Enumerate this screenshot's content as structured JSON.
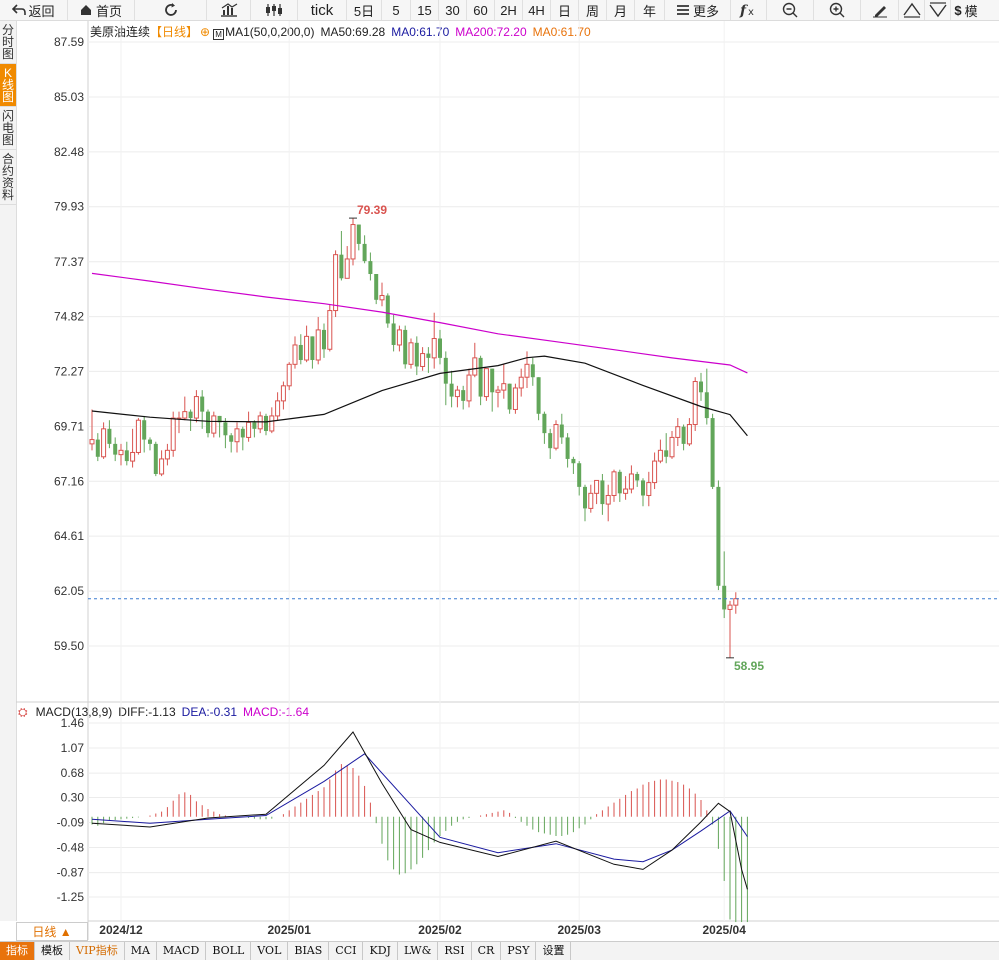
{
  "toolbar": {
    "back_label": "返回",
    "home_label": "首页",
    "tick_label": "tick",
    "periods": [
      "5日",
      "5",
      "15",
      "30",
      "60",
      "2H",
      "4H",
      "日",
      "周",
      "月",
      "年"
    ],
    "more_label": "更多",
    "model_label": "模"
  },
  "sidebar": {
    "items": [
      "分时图",
      "K线图",
      "闪电图",
      "合约资料"
    ],
    "active_index": 1
  },
  "main_legend": {
    "name": "美原油连续",
    "period": "【日线】",
    "ma_params": "MA1(50,0,200,0)",
    "ma50": "MA50:69.28",
    "ma0_a": "MA0:61.70",
    "ma200": "MA200:72.20",
    "ma0_b": "MA0:61.70"
  },
  "macd_legend": {
    "name": "MACD(13,8,9)",
    "diff": "DIFF:-1.13",
    "dea": "DEA:-0.31",
    "macd": "MACD:-1.64"
  },
  "period_tag": "日线 ▲",
  "bottom_tabs": [
    "指标",
    "模板",
    "VIP指标",
    "MA",
    "MACD",
    "BOLL",
    "VOL",
    "BIAS",
    "CCI",
    "KDJ",
    "LW&",
    "RSI",
    "CR",
    "PSY",
    "设置"
  ],
  "colors": {
    "up": "#d9534f",
    "down": "#62a65a",
    "ma50": "#111111",
    "ma200": "#cc00cc",
    "dea": "#1a1aa0",
    "accent": "#f08a00",
    "last_price_line": "#3b7bd0"
  },
  "chart_data": {
    "type": "candlestick",
    "title": "美原油连续",
    "price_axis_ticks": [
      87.59,
      85.03,
      82.48,
      79.93,
      77.37,
      74.82,
      72.27,
      69.71,
      67.16,
      64.61,
      62.05,
      59.5
    ],
    "ylim": [
      58.2,
      88.2
    ],
    "x_labels": [
      "2024/12",
      "2025/01",
      "2025/02",
      "2025/03",
      "2025/04"
    ],
    "high_annotation": "79.39",
    "low_annotation": "58.95",
    "last_price": 61.7,
    "candles": [
      [
        68.9,
        69.1,
        68.6,
        70.5
      ],
      [
        69.1,
        68.3,
        68.1,
        69.4
      ],
      [
        68.3,
        69.6,
        68.2,
        69.9
      ],
      [
        69.6,
        68.9,
        68.7,
        70.0
      ],
      [
        68.9,
        68.4,
        68.1,
        69.2
      ],
      [
        68.4,
        68.6,
        67.9,
        68.9
      ],
      [
        68.6,
        68.1,
        67.9,
        69.0
      ],
      [
        68.1,
        68.5,
        67.8,
        69.6
      ],
      [
        68.5,
        70.0,
        68.4,
        70.1
      ],
      [
        70.0,
        69.1,
        68.5,
        70.2
      ],
      [
        69.1,
        68.9,
        68.6,
        69.2
      ],
      [
        68.9,
        67.5,
        67.4,
        69.0
      ],
      [
        67.5,
        68.2,
        67.4,
        68.6
      ],
      [
        68.2,
        68.6,
        67.9,
        68.9
      ],
      [
        68.6,
        70.1,
        68.3,
        70.4
      ],
      [
        70.1,
        70.1,
        69.4,
        70.4
      ],
      [
        70.1,
        70.4,
        70.0,
        71.1
      ],
      [
        70.4,
        70.1,
        69.5,
        70.5
      ],
      [
        70.1,
        71.1,
        69.9,
        71.4
      ],
      [
        71.1,
        70.4,
        69.6,
        71.4
      ],
      [
        70.4,
        69.4,
        69.2,
        70.5
      ],
      [
        69.4,
        70.2,
        69.2,
        70.4
      ],
      [
        70.2,
        69.9,
        69.2,
        70.2
      ],
      [
        69.9,
        69.3,
        68.7,
        70.1
      ],
      [
        69.3,
        69.0,
        68.5,
        69.4
      ],
      [
        69.0,
        69.6,
        68.5,
        69.9
      ],
      [
        69.6,
        69.2,
        68.6,
        69.7
      ],
      [
        69.2,
        69.9,
        69.0,
        70.4
      ],
      [
        69.9,
        69.6,
        69.2,
        70.0
      ],
      [
        69.6,
        70.2,
        69.4,
        70.4
      ],
      [
        70.2,
        69.5,
        69.3,
        70.3
      ],
      [
        69.5,
        70.2,
        69.4,
        70.6
      ],
      [
        70.2,
        70.9,
        70.0,
        71.3
      ],
      [
        70.9,
        71.6,
        70.5,
        71.8
      ],
      [
        71.6,
        72.6,
        71.4,
        72.7
      ],
      [
        72.6,
        73.5,
        72.4,
        73.9
      ],
      [
        73.5,
        72.8,
        72.6,
        74.0
      ],
      [
        72.8,
        73.9,
        72.7,
        74.4
      ],
      [
        73.9,
        72.8,
        72.4,
        73.9
      ],
      [
        72.8,
        74.2,
        72.6,
        74.8
      ],
      [
        74.2,
        73.3,
        72.9,
        74.5
      ],
      [
        73.3,
        75.1,
        73.2,
        75.4
      ],
      [
        75.1,
        77.7,
        74.8,
        77.9
      ],
      [
        77.7,
        76.6,
        76.5,
        78.8
      ],
      [
        76.6,
        77.5,
        76.6,
        78.1
      ],
      [
        77.5,
        79.1,
        77.2,
        79.4
      ],
      [
        79.1,
        78.2,
        77.9,
        79.1
      ],
      [
        78.2,
        77.4,
        77.3,
        78.6
      ],
      [
        77.4,
        76.8,
        76.5,
        77.8
      ],
      [
        76.8,
        75.6,
        75.4,
        76.8
      ],
      [
        75.6,
        75.8,
        75.3,
        76.4
      ],
      [
        75.8,
        74.5,
        74.3,
        75.9
      ],
      [
        74.5,
        73.5,
        73.2,
        74.9
      ],
      [
        73.5,
        74.2,
        73.2,
        74.4
      ],
      [
        74.2,
        72.6,
        72.4,
        74.4
      ],
      [
        72.6,
        73.6,
        72.4,
        73.8
      ],
      [
        73.6,
        72.5,
        72.1,
        73.9
      ],
      [
        72.5,
        73.1,
        72.3,
        73.4
      ],
      [
        73.1,
        72.9,
        72.2,
        73.4
      ],
      [
        72.9,
        73.8,
        72.4,
        75.0
      ],
      [
        73.8,
        72.9,
        72.6,
        74.2
      ],
      [
        72.9,
        71.7,
        70.7,
        73.2
      ],
      [
        71.7,
        71.1,
        70.6,
        72.3
      ],
      [
        71.1,
        71.4,
        70.6,
        71.6
      ],
      [
        71.4,
        70.9,
        70.5,
        71.6
      ],
      [
        70.9,
        72.1,
        70.6,
        72.4
      ],
      [
        72.1,
        72.9,
        72.0,
        73.6
      ],
      [
        72.9,
        71.1,
        70.7,
        73.0
      ],
      [
        71.1,
        72.4,
        70.9,
        72.4
      ],
      [
        72.4,
        71.3,
        70.4,
        72.4
      ],
      [
        71.3,
        71.4,
        70.6,
        71.6
      ],
      [
        71.4,
        71.7,
        71.0,
        72.6
      ],
      [
        71.7,
        70.5,
        70.3,
        71.7
      ],
      [
        70.5,
        71.5,
        70.3,
        71.7
      ],
      [
        71.5,
        72.0,
        71.1,
        72.4
      ],
      [
        72.0,
        72.6,
        71.5,
        73.2
      ],
      [
        72.6,
        72.0,
        71.6,
        72.9
      ],
      [
        72.0,
        70.3,
        70.0,
        72.0
      ],
      [
        70.3,
        69.4,
        68.9,
        70.4
      ],
      [
        69.4,
        68.7,
        68.2,
        69.6
      ],
      [
        68.7,
        69.8,
        68.6,
        70.0
      ],
      [
        69.8,
        69.2,
        68.9,
        70.3
      ],
      [
        69.2,
        68.2,
        67.8,
        69.4
      ],
      [
        68.2,
        68.0,
        67.5,
        68.3
      ],
      [
        68.0,
        66.9,
        66.5,
        68.1
      ],
      [
        66.9,
        65.9,
        65.3,
        67.0
      ],
      [
        65.9,
        66.6,
        65.7,
        67.0
      ],
      [
        66.6,
        67.2,
        66.1,
        67.2
      ],
      [
        67.2,
        66.1,
        65.6,
        67.5
      ],
      [
        66.1,
        66.5,
        65.3,
        67.0
      ],
      [
        66.5,
        67.6,
        66.2,
        67.7
      ],
      [
        67.6,
        66.6,
        66.2,
        67.7
      ],
      [
        66.6,
        66.8,
        66.3,
        67.4
      ],
      [
        66.8,
        67.5,
        66.6,
        67.9
      ],
      [
        67.5,
        67.2,
        66.9,
        67.6
      ],
      [
        67.2,
        66.5,
        66.0,
        67.3
      ],
      [
        66.5,
        67.1,
        66.0,
        67.6
      ],
      [
        67.1,
        68.1,
        66.8,
        68.5
      ],
      [
        68.1,
        68.6,
        68.0,
        69.1
      ],
      [
        68.6,
        68.3,
        68.0,
        69.4
      ],
      [
        68.3,
        69.2,
        68.2,
        69.5
      ],
      [
        69.2,
        69.7,
        68.8,
        70.1
      ],
      [
        69.7,
        68.9,
        68.6,
        69.8
      ],
      [
        68.9,
        69.8,
        68.8,
        70.1
      ],
      [
        69.8,
        71.8,
        69.5,
        72.0
      ],
      [
        71.8,
        71.3,
        70.9,
        72.2
      ],
      [
        71.3,
        70.1,
        69.8,
        72.4
      ],
      [
        70.1,
        66.9,
        66.8,
        70.3
      ],
      [
        66.9,
        62.3,
        62.1,
        67.2
      ],
      [
        62.3,
        61.2,
        60.8,
        63.9
      ],
      [
        61.2,
        61.4,
        58.95,
        61.6
      ],
      [
        61.4,
        61.7,
        61.0,
        62.0
      ]
    ],
    "ma50_points": [
      [
        0,
        70.43
      ],
      [
        10,
        70.14
      ],
      [
        20,
        69.95
      ],
      [
        30,
        69.92
      ],
      [
        40,
        70.27
      ],
      [
        50,
        71.38
      ],
      [
        60,
        72.18
      ],
      [
        70,
        72.54
      ],
      [
        75,
        72.91
      ],
      [
        78,
        72.98
      ],
      [
        85,
        72.65
      ],
      [
        95,
        71.62
      ],
      [
        105,
        70.64
      ],
      [
        110,
        70.26
      ],
      [
        113,
        69.28
      ]
    ],
    "ma200_points": [
      [
        0,
        76.83
      ],
      [
        10,
        76.47
      ],
      [
        20,
        76.09
      ],
      [
        30,
        75.73
      ],
      [
        40,
        75.42
      ],
      [
        50,
        75.03
      ],
      [
        60,
        74.54
      ],
      [
        70,
        74.02
      ],
      [
        80,
        73.65
      ],
      [
        90,
        73.28
      ],
      [
        100,
        72.9
      ],
      [
        110,
        72.57
      ],
      [
        113,
        72.2
      ]
    ],
    "macd": {
      "axis_ticks": [
        1.46,
        1.07,
        0.68,
        0.3,
        -0.09,
        -0.48,
        -0.87,
        -1.25
      ],
      "ylim": [
        -1.65,
        1.65
      ],
      "diff_points": [
        [
          0,
          -0.1
        ],
        [
          10,
          -0.16
        ],
        [
          20,
          -0.02
        ],
        [
          30,
          0.04
        ],
        [
          40,
          0.8
        ],
        [
          45,
          1.32
        ],
        [
          50,
          0.52
        ],
        [
          55,
          -0.2
        ],
        [
          60,
          -0.4
        ],
        [
          70,
          -0.62
        ],
        [
          80,
          -0.38
        ],
        [
          90,
          -0.74
        ],
        [
          95,
          -0.82
        ],
        [
          100,
          -0.52
        ],
        [
          105,
          -0.08
        ],
        [
          108,
          0.21
        ],
        [
          110,
          0.08
        ],
        [
          112,
          -0.82
        ],
        [
          113,
          -1.13
        ]
      ],
      "dea_points": [
        [
          0,
          -0.04
        ],
        [
          10,
          -0.1
        ],
        [
          20,
          -0.04
        ],
        [
          30,
          0.02
        ],
        [
          40,
          0.55
        ],
        [
          47,
          0.98
        ],
        [
          55,
          0.18
        ],
        [
          60,
          -0.32
        ],
        [
          70,
          -0.56
        ],
        [
          80,
          -0.42
        ],
        [
          90,
          -0.66
        ],
        [
          95,
          -0.7
        ],
        [
          100,
          -0.52
        ],
        [
          105,
          -0.22
        ],
        [
          110,
          0.09
        ],
        [
          113,
          -0.31
        ]
      ],
      "hist_values": [
        -0.12,
        -0.14,
        -0.1,
        -0.06,
        -0.05,
        -0.04,
        -0.03,
        -0.02,
        -0.01,
        0.0,
        0.02,
        0.05,
        0.08,
        0.15,
        0.25,
        0.35,
        0.38,
        0.34,
        0.24,
        0.18,
        0.12,
        0.08,
        0.04,
        0.02,
        0.01,
        0.0,
        -0.01,
        -0.02,
        -0.03,
        -0.04,
        -0.04,
        -0.03,
        0.0,
        0.04,
        0.1,
        0.16,
        0.22,
        0.28,
        0.34,
        0.4,
        0.46,
        0.58,
        0.72,
        0.82,
        0.8,
        0.76,
        0.64,
        0.48,
        0.22,
        -0.1,
        -0.42,
        -0.68,
        -0.82,
        -0.9,
        -0.88,
        -0.82,
        -0.74,
        -0.64,
        -0.52,
        -0.4,
        -0.3,
        -0.22,
        -0.14,
        -0.08,
        -0.04,
        -0.02,
        0.0,
        0.02,
        0.04,
        0.06,
        0.08,
        0.1,
        0.06,
        -0.02,
        -0.08,
        -0.14,
        -0.2,
        -0.24,
        -0.26,
        -0.28,
        -0.3,
        -0.3,
        -0.28,
        -0.24,
        -0.18,
        -0.12,
        -0.04,
        0.04,
        0.1,
        0.16,
        0.22,
        0.28,
        0.34,
        0.4,
        0.44,
        0.5,
        0.54,
        0.56,
        0.58,
        0.58,
        0.56,
        0.54,
        0.5,
        0.44,
        0.36,
        0.26,
        0.1,
        -0.12,
        -0.5,
        -1.0,
        -1.6,
        -1.64,
        -1.64,
        -1.64
      ]
    }
  }
}
